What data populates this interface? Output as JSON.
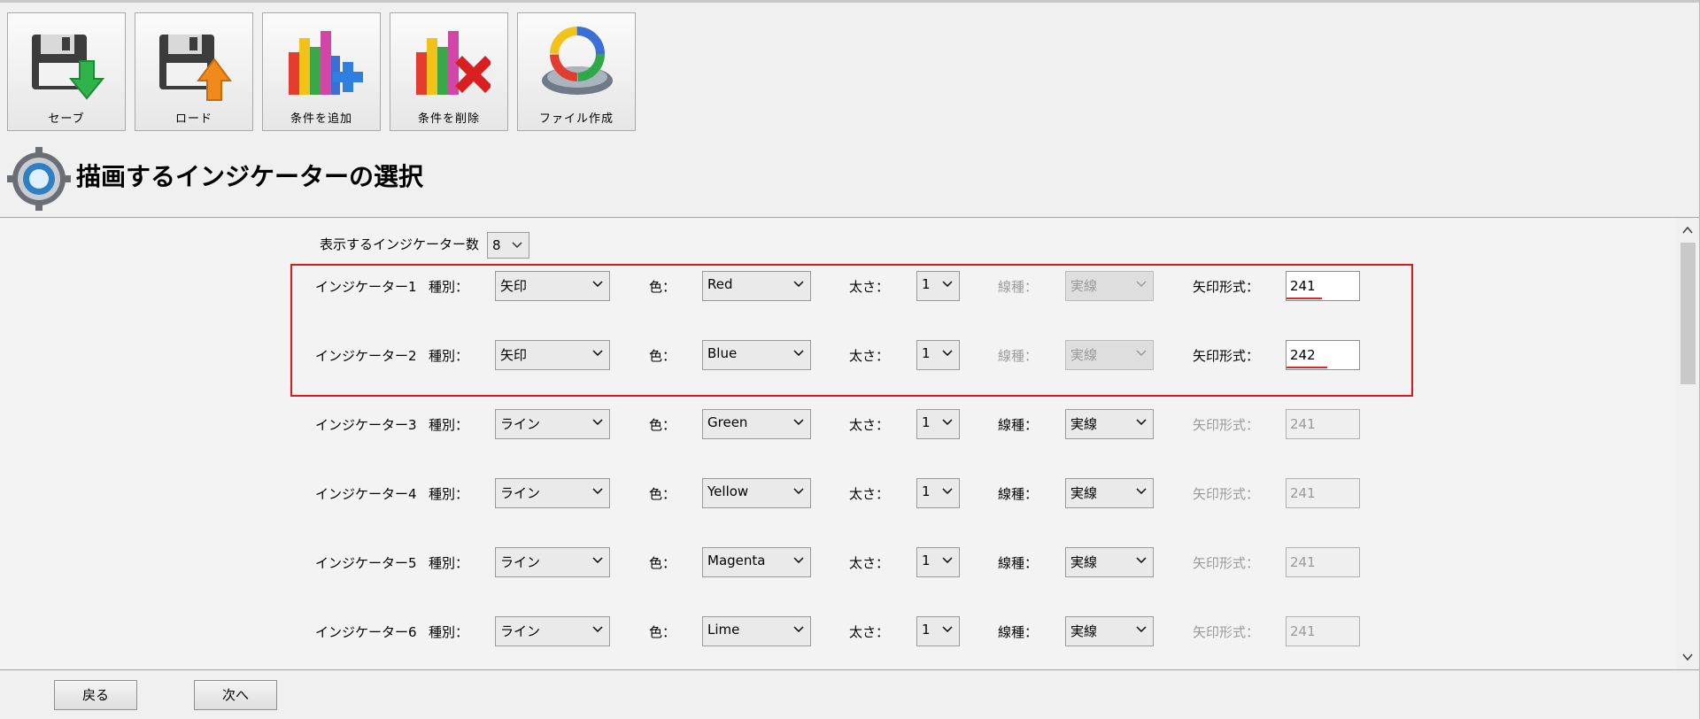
{
  "toolbar": {
    "buttons": [
      {
        "label": "セーブ",
        "icon": "save-disk-download-icon"
      },
      {
        "label": "ロード",
        "icon": "load-disk-upload-icon"
      },
      {
        "label": "条件を追加",
        "icon": "add-condition-chart-icon"
      },
      {
        "label": "条件を削除",
        "icon": "delete-condition-chart-icon"
      },
      {
        "label": "ファイル作成",
        "icon": "create-file-gear-ring-icon"
      }
    ]
  },
  "heading": {
    "title": "描画するインジケーターの選択",
    "icon": "settings-gear-icon"
  },
  "indicator_count": {
    "label": "表示するインジケーター数",
    "value": "8"
  },
  "field_labels": {
    "type": "種別：",
    "color": "色：",
    "width": "太さ：",
    "line_style": "線種：",
    "arrow_code": "矢印形式："
  },
  "indicators": [
    {
      "name": "インジケーター1",
      "type": "矢印",
      "color": "Red",
      "width": "1",
      "line_style": "実線",
      "arrow_code": "241",
      "line_style_enabled": false,
      "arrow_enabled": true
    },
    {
      "name": "インジケーター2",
      "type": "矢印",
      "color": "Blue",
      "width": "1",
      "line_style": "実線",
      "arrow_code": "242",
      "line_style_enabled": false,
      "arrow_enabled": true
    },
    {
      "name": "インジケーター3",
      "type": "ライン",
      "color": "Green",
      "width": "1",
      "line_style": "実線",
      "arrow_code": "241",
      "line_style_enabled": true,
      "arrow_enabled": false
    },
    {
      "name": "インジケーター4",
      "type": "ライン",
      "color": "Yellow",
      "width": "1",
      "line_style": "実線",
      "arrow_code": "241",
      "line_style_enabled": true,
      "arrow_enabled": false
    },
    {
      "name": "インジケーター5",
      "type": "ライン",
      "color": "Magenta",
      "width": "1",
      "line_style": "実線",
      "arrow_code": "241",
      "line_style_enabled": true,
      "arrow_enabled": false
    },
    {
      "name": "インジケーター6",
      "type": "ライン",
      "color": "Lime",
      "width": "1",
      "line_style": "実線",
      "arrow_code": "241",
      "line_style_enabled": true,
      "arrow_enabled": false
    }
  ],
  "colors": {
    "highlight_border": "#d81a22",
    "spell_underline": "#e0262d",
    "disabled_text": "#9a9a9a"
  },
  "footer": {
    "back_label": "戻る",
    "next_label": "次へ"
  }
}
